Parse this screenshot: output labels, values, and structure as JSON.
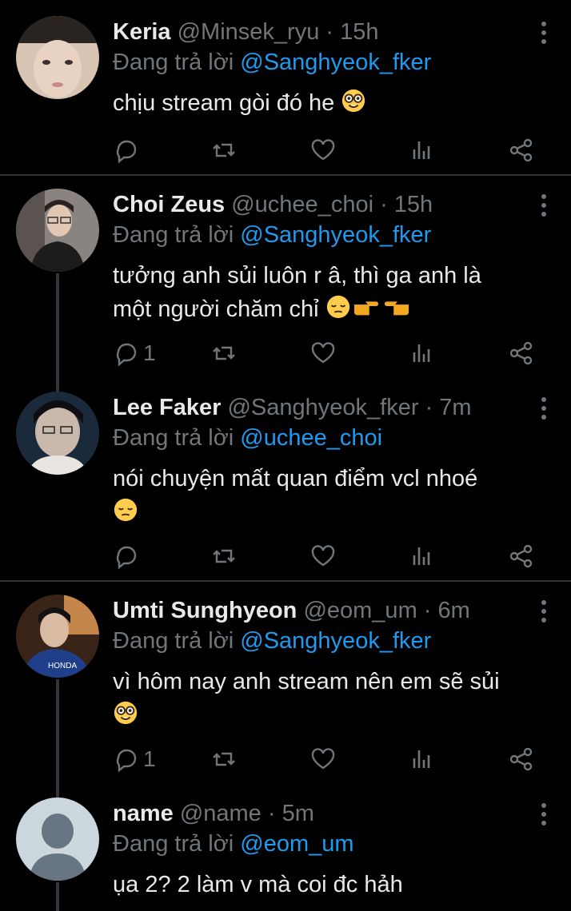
{
  "reply_prefix": "Đang trả lời",
  "colors": {
    "background": "#000000",
    "text": "#e7e9ea",
    "secondary": "#71767b",
    "mention": "#1d9bf0",
    "divider": "#2f3336"
  },
  "tweets": [
    {
      "name": "Keria",
      "handle": "@Minsek_ryu",
      "time": "· 15h",
      "reply_to": "@Sanghyeok_fker",
      "text": "chịu stream gòi đó he",
      "emoji": [
        "nerd-face"
      ],
      "reply_count": "",
      "avatar": "person-photo"
    },
    {
      "name": "Choi Zeus",
      "handle": "@uchee_choi",
      "time": "· 15h",
      "reply_to": "@Sanghyeok_fker",
      "text_line1": "tưởng anh sủi luôn r â, thì ga anh là",
      "text_line2": "một người chăm chỉ",
      "emoji": [
        "pensive-face",
        "pointing-right",
        "pointing-left"
      ],
      "reply_count": "1",
      "avatar": "person-photo"
    },
    {
      "name": "Lee Faker",
      "handle": "@Sanghyeok_fker",
      "time": "· 7m",
      "reply_to": "@uchee_choi",
      "text": "nói chuyện mất quan điểm vcl nhoé",
      "emoji": [
        "pensive-face"
      ],
      "reply_count": "",
      "avatar": "person-photo"
    },
    {
      "name": "Umti Sunghyeon",
      "handle": "@eom_um",
      "time": "· 6m",
      "reply_to": "@Sanghyeok_fker",
      "text": "vì hôm nay anh stream nên em sẽ sủi",
      "emoji": [
        "nerd-face"
      ],
      "reply_count": "1",
      "avatar": "person-photo"
    },
    {
      "name": "name",
      "handle": "@name",
      "time": "· 5m",
      "reply_to": "@eom_um",
      "text": "ụa 2? 2 làm v mà coi đc hảh",
      "emoji": [],
      "reply_count": "",
      "avatar": "default-avatar"
    }
  ],
  "action_icons": [
    "reply-icon",
    "retweet-icon",
    "like-icon",
    "analytics-icon",
    "share-icon"
  ]
}
